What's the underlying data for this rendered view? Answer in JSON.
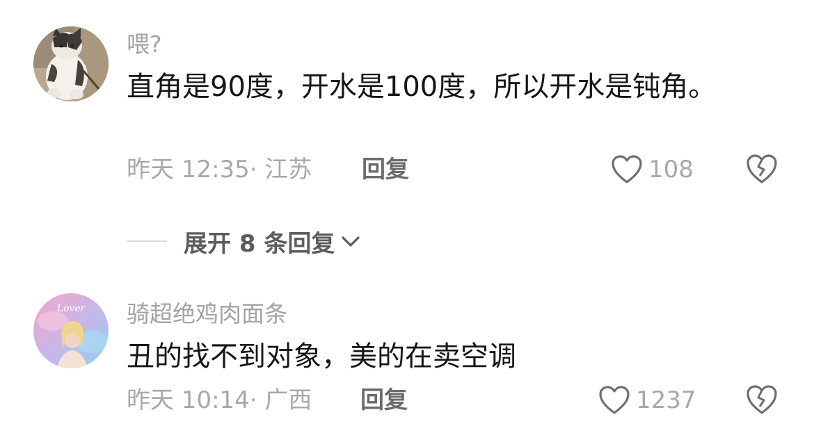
{
  "comments": [
    {
      "username": "喂?",
      "text": "直角是90度，开水是100度，所以开水是钝角。",
      "meta": "昨天 12:35· 江苏",
      "reply_label": "回复",
      "likes": "108",
      "expand_label": "展开 8 条回复"
    },
    {
      "username": "骑超绝鸡肉面条",
      "text": "丑的找不到对象，美的在卖空调",
      "meta": "昨天 10:14· 广西",
      "reply_label": "回复",
      "likes": "1237",
      "avatar_caption": "Lover"
    }
  ]
}
